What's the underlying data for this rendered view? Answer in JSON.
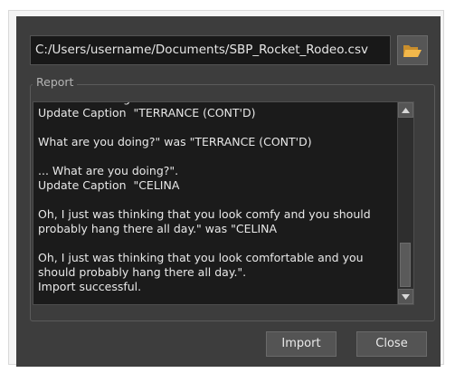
{
  "file_path": "C:/Users/username/Documents/SBP_Rocket_Rodeo.csv",
  "report": {
    "label": "Report",
    "log_text": "Are we hovering?\".\nUpdate Caption  \"TERRANCE (CONT'D)\n\nWhat are you doing?\" was \"TERRANCE (CONT'D)\n\n... What are you doing?\".\nUpdate Caption  \"CELINA\n\nOh, I just was thinking that you look comfy and you should probably hang there all day.\" was \"CELINA\n\nOh, I just was thinking that you look comfortable and you should probably hang there all day.\".\nImport successful."
  },
  "buttons": {
    "import": "Import",
    "close": "Close"
  },
  "icons": {
    "browse": "folder-open-icon",
    "scroll_up": "arrow-up-icon",
    "scroll_down": "arrow-down-icon"
  },
  "colors": {
    "dialog_bg": "#3d3d3d",
    "field_bg": "#181818",
    "folder": "#f0b64a"
  }
}
